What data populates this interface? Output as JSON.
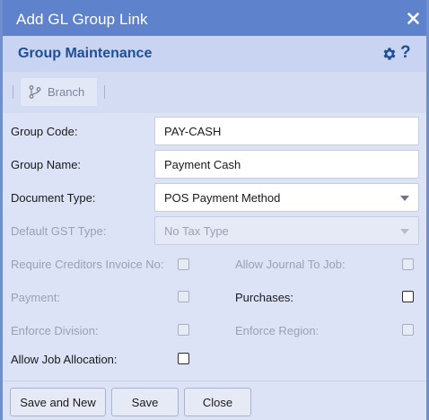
{
  "window": {
    "title": "Add GL Group Link"
  },
  "header": {
    "title": "Group Maintenance",
    "help_label": "?"
  },
  "toolbar": {
    "branch_label": "Branch"
  },
  "form": {
    "group_code": {
      "label": "Group Code:",
      "value": "PAY-CASH"
    },
    "group_name": {
      "label": "Group Name:",
      "value": "Payment Cash"
    },
    "document_type": {
      "label": "Document Type:",
      "value": "POS Payment Method"
    },
    "default_gst_type": {
      "label": "Default GST Type:",
      "value": "No Tax Type"
    },
    "require_creditors_invoice_no": {
      "label": "Require Creditors Invoice No:",
      "checked": false,
      "enabled": false
    },
    "allow_journal_to_job": {
      "label": "Allow Journal To Job:",
      "checked": false,
      "enabled": false
    },
    "payment": {
      "label": "Payment:",
      "checked": false,
      "enabled": false
    },
    "purchases": {
      "label": "Purchases:",
      "checked": false,
      "enabled": true
    },
    "enforce_division": {
      "label": "Enforce Division:",
      "checked": false,
      "enabled": false
    },
    "enforce_region": {
      "label": "Enforce Region:",
      "checked": false,
      "enabled": false
    },
    "allow_job_allocation": {
      "label": "Allow Job Allocation:",
      "checked": false,
      "enabled": true
    }
  },
  "footer": {
    "save_and_new_label": "Save and New",
    "save_label": "Save",
    "close_label": "Close"
  },
  "colors": {
    "titlebar": "#5f82cc",
    "header": "#c8d4f2",
    "accent_text": "#1f4f96",
    "body": "#dce3f7"
  },
  "icons": {
    "close": "close-icon",
    "settings": "gear-icon",
    "help": "help-icon",
    "branch": "branch-icon",
    "dropdown": "chevron-down-icon"
  }
}
